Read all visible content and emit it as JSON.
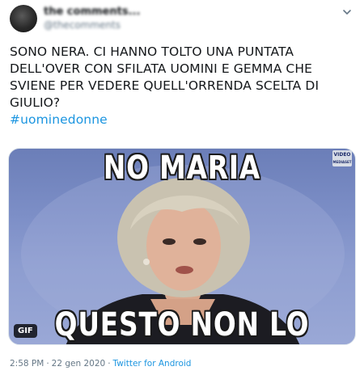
{
  "author": {
    "display_name": "the comments...",
    "handle": "@thecomments"
  },
  "tweet": {
    "lines": [
      "SONO NERA. CI HANNO TOLTO UNA PUNTATA",
      "DELL'OVER CON SFILATA UOMINI E GEMMA CHE",
      "SVIENE PER VEDERE QUELL'ORRENDA SCELTA DI",
      "GIULIO?"
    ],
    "hashtag": "#uominedonne"
  },
  "media": {
    "caption_top": "NO MARIA",
    "caption_bottom": "QUESTO NON LO ACCETTO",
    "gif_badge": "GIF",
    "channel_logo_line1": "VIDEO",
    "channel_logo_line2": "MEDIASET"
  },
  "meta": {
    "time": "2:58 PM",
    "separator": "·",
    "date": "22 gen 2020",
    "source": "Twitter for Android"
  },
  "colors": {
    "link": "#1b95e0",
    "secondary_text": "#657786",
    "primary_text": "#14171a"
  },
  "icons": [
    "chevron-down-icon"
  ]
}
